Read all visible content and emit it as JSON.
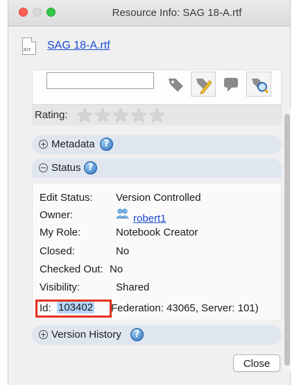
{
  "window": {
    "title": "Resource Info: SAG 18-A.rtf"
  },
  "file": {
    "icon_label": "RTF",
    "name": "SAG 18-A.rtf"
  },
  "tags": {
    "input_value": "",
    "icons": [
      "tag-icon",
      "tag-edit-icon",
      "comment-icon",
      "tag-search-icon"
    ]
  },
  "rating": {
    "label": "Rating:",
    "stars_total": 5,
    "stars_filled": 0
  },
  "metadata_section": {
    "label": "Metadata",
    "toggle": "+",
    "help": "?"
  },
  "status_section": {
    "label": "Status",
    "toggle": "−",
    "help": "?",
    "fields": {
      "edit_status": {
        "label": "Edit Status:",
        "value": "Version Controlled"
      },
      "owner": {
        "label": "Owner:",
        "value": "robert1"
      },
      "my_role": {
        "label": "My Role:",
        "value": "Notebook Creator"
      },
      "closed": {
        "label": "Closed:",
        "value": "No"
      },
      "checked_out": {
        "label": "Checked Out:",
        "value": "No"
      },
      "visibility": {
        "label": "Visibility:",
        "value": "Shared"
      }
    },
    "id": {
      "label": "Id:",
      "value": "103402",
      "rest": "Federation: 43065, Server: 101)"
    }
  },
  "version_history_section": {
    "label": "Version History",
    "toggle": "+",
    "help": "?"
  },
  "buttons": {
    "close_label": "Close"
  },
  "colors": {
    "link": "#1a4ad6",
    "section_bar": "#dfe6f0",
    "id_highlight_box": "#e3311b",
    "id_selection": "#b5d5fb"
  }
}
